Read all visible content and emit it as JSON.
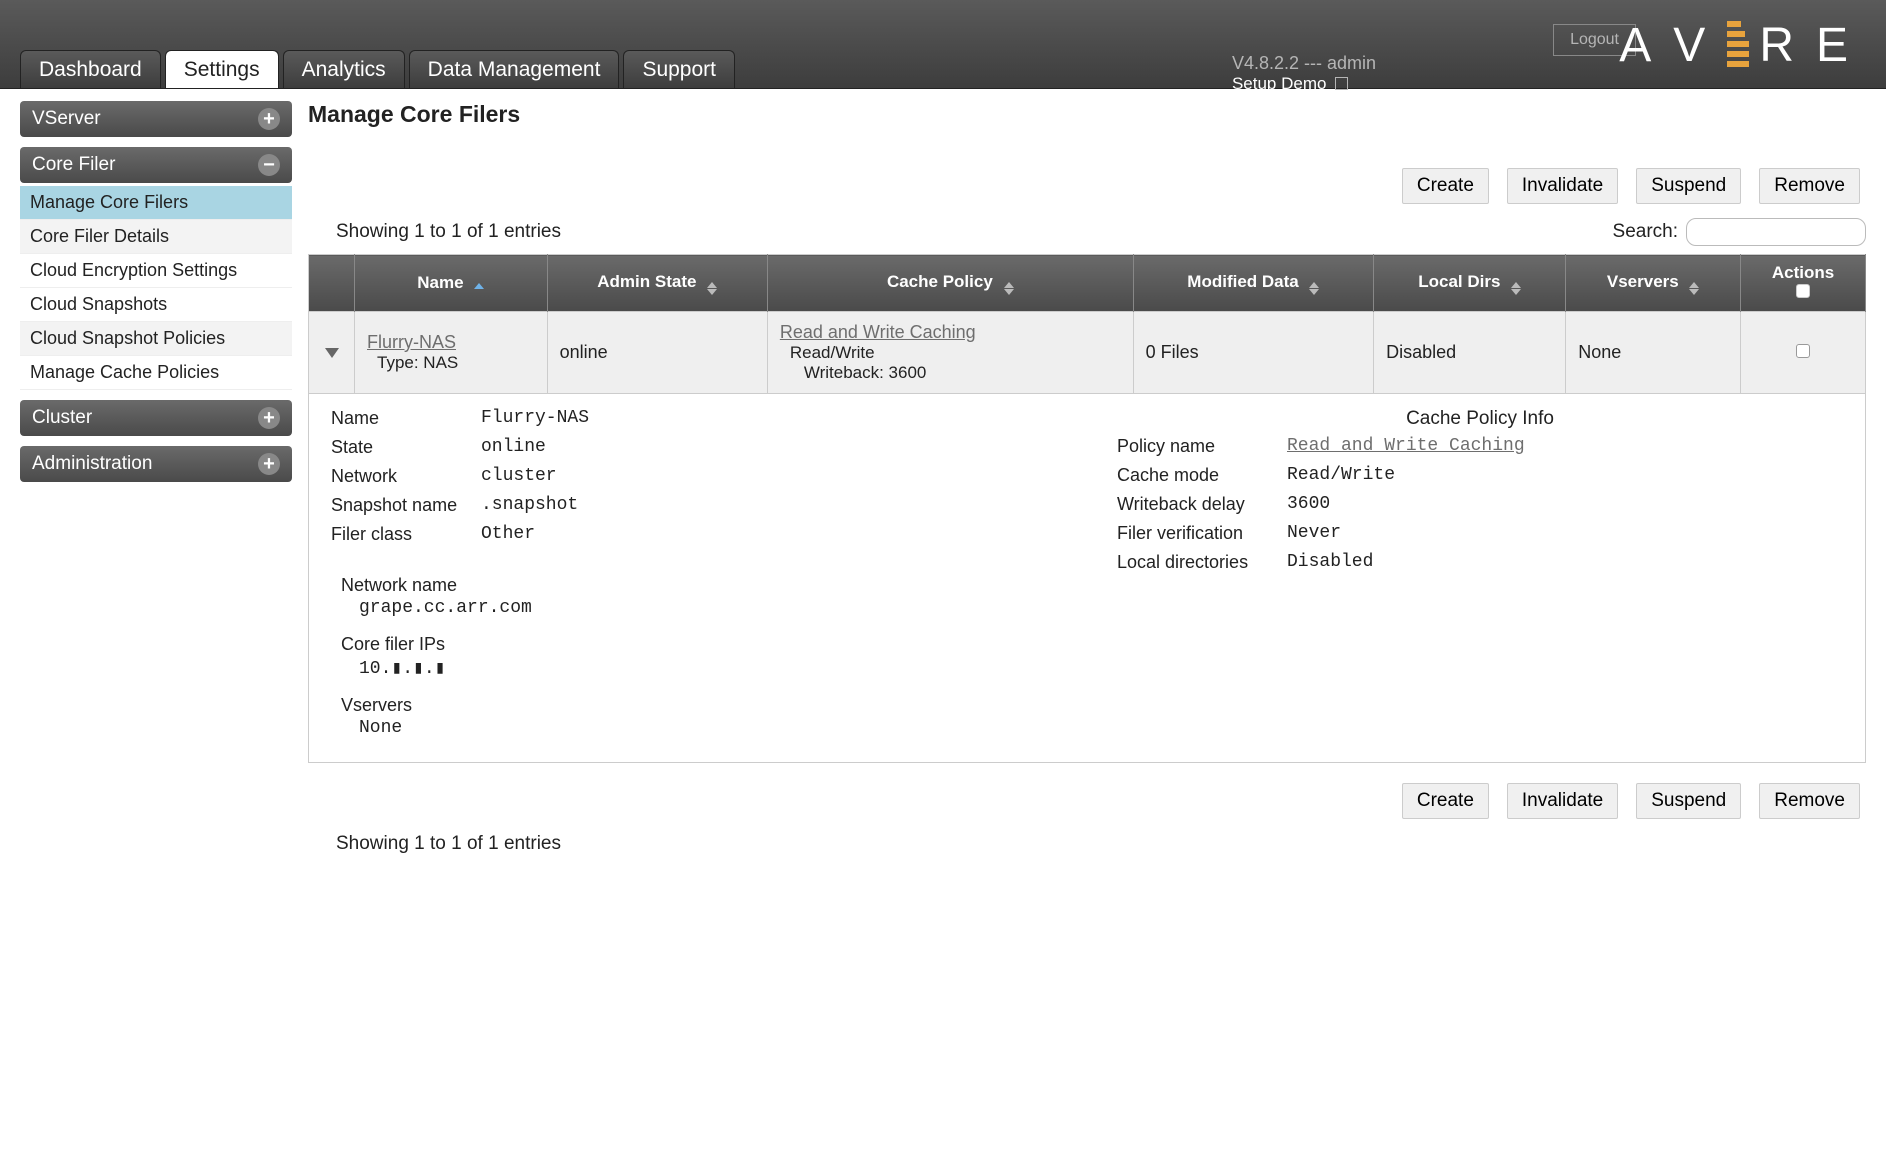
{
  "header": {
    "logout": "Logout",
    "version": "V4.8.2.2 --- admin",
    "setup_demo": "Setup Demo",
    "logo_letters": [
      "A",
      "V",
      "E",
      "R",
      "E"
    ]
  },
  "tabs": [
    {
      "label": "Dashboard",
      "active": false
    },
    {
      "label": "Settings",
      "active": true
    },
    {
      "label": "Analytics",
      "active": false
    },
    {
      "label": "Data Management",
      "active": false
    },
    {
      "label": "Support",
      "active": false
    }
  ],
  "sidebar": {
    "vserver": {
      "label": "VServer",
      "expanded": false
    },
    "core_filer": {
      "label": "Core Filer",
      "expanded": true,
      "items": [
        {
          "label": "Manage Core Filers",
          "active": true,
          "alt": false
        },
        {
          "label": "Core Filer Details",
          "active": false,
          "alt": true
        },
        {
          "label": "Cloud Encryption Settings",
          "active": false,
          "alt": false
        },
        {
          "label": "Cloud Snapshots",
          "active": false,
          "alt": false
        },
        {
          "label": "Cloud Snapshot Policies",
          "active": false,
          "alt": true
        },
        {
          "label": "Manage Cache Policies",
          "active": false,
          "alt": false
        }
      ]
    },
    "cluster": {
      "label": "Cluster",
      "expanded": false
    },
    "administration": {
      "label": "Administration",
      "expanded": false
    }
  },
  "main": {
    "title": "Manage Core Filers",
    "actions": {
      "create": "Create",
      "invalidate": "Invalidate",
      "suspend": "Suspend",
      "remove": "Remove"
    },
    "showing": "Showing 1 to 1 of 1 entries",
    "search_label": "Search:",
    "columns": {
      "name": "Name",
      "admin_state": "Admin State",
      "cache_policy": "Cache Policy",
      "modified_data": "Modified Data",
      "local_dirs": "Local Dirs",
      "vservers": "Vservers",
      "actions": "Actions"
    },
    "row": {
      "name_link": "Flurry-NAS",
      "type_label": "Type: NAS",
      "admin_state": "online",
      "cache_policy_link": "Read and Write Caching",
      "cache_mode_line": "Read/Write",
      "writeback_line": "Writeback: 3600",
      "modified_data": "0 Files",
      "local_dirs": "Disabled",
      "vservers": "None"
    },
    "details": {
      "left": {
        "name_l": "Name",
        "name_v": "Flurry-NAS",
        "state_l": "State",
        "state_v": "online",
        "network_l": "Network",
        "network_v": "cluster",
        "snapshot_l": "Snapshot name",
        "snapshot_v": ".snapshot",
        "class_l": "Filer class",
        "class_v": "Other"
      },
      "right": {
        "section_title": "Cache Policy Info",
        "policy_l": "Policy name",
        "policy_v": "Read and Write Caching",
        "mode_l": "Cache mode",
        "mode_v": "Read/Write",
        "wb_l": "Writeback delay",
        "wb_v": "3600",
        "verify_l": "Filer verification",
        "verify_v": "Never",
        "ld_l": "Local directories",
        "ld_v": "Disabled"
      },
      "net": {
        "netname_l": "Network name",
        "netname_v": "grape.cc.arr.com",
        "ips_l": "Core filer IPs",
        "ips_v": "10.▮.▮.▮",
        "vs_l": "Vservers",
        "vs_v": "None"
      }
    }
  }
}
